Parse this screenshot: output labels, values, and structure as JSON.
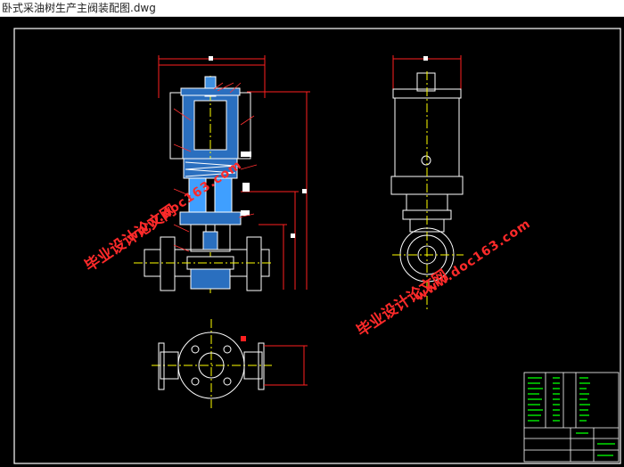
{
  "window": {
    "title": "卧式采油树生产主阀装配图.dwg"
  },
  "watermark": {
    "left_line1": "毕业设计论文网",
    "left_line2": "www.doc163.com",
    "right_line1": "毕业设计论文网",
    "right_line2": "www.doc163.com"
  },
  "colors": {
    "background": "#000000",
    "border": "#ffffff",
    "part": "#ffffff",
    "dimension": "#ff2020",
    "leader": "#ff3030",
    "center": "#ffff00",
    "hatch": "#3f9fff",
    "table_text": "#00e000",
    "watermark": "#ff2a2a"
  }
}
